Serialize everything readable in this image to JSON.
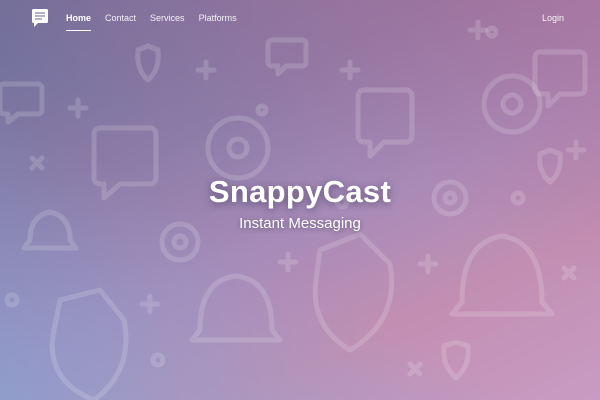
{
  "nav": {
    "logo_icon": "chat-bubble-icon",
    "links": [
      {
        "label": "Home",
        "active": true
      },
      {
        "label": "Contact",
        "active": false
      },
      {
        "label": "Services",
        "active": false
      },
      {
        "label": "Platforms",
        "active": false
      }
    ],
    "login_label": "Login"
  },
  "hero": {
    "title": "SnappyCast",
    "subtitle": "Instant Messaging",
    "background_pattern_icons": [
      "chat-bubble-icon",
      "gear-icon",
      "bell-icon",
      "shield-icon",
      "plus-icon",
      "x-icon",
      "ring-icon"
    ]
  },
  "colors": {
    "gradient_top_left": "#6b6f9a",
    "gradient_top_right": "#b46e96",
    "gradient_bottom_left": "#78aadc",
    "gradient_bottom_right": "#c99bc4",
    "text": "#ffffff"
  }
}
